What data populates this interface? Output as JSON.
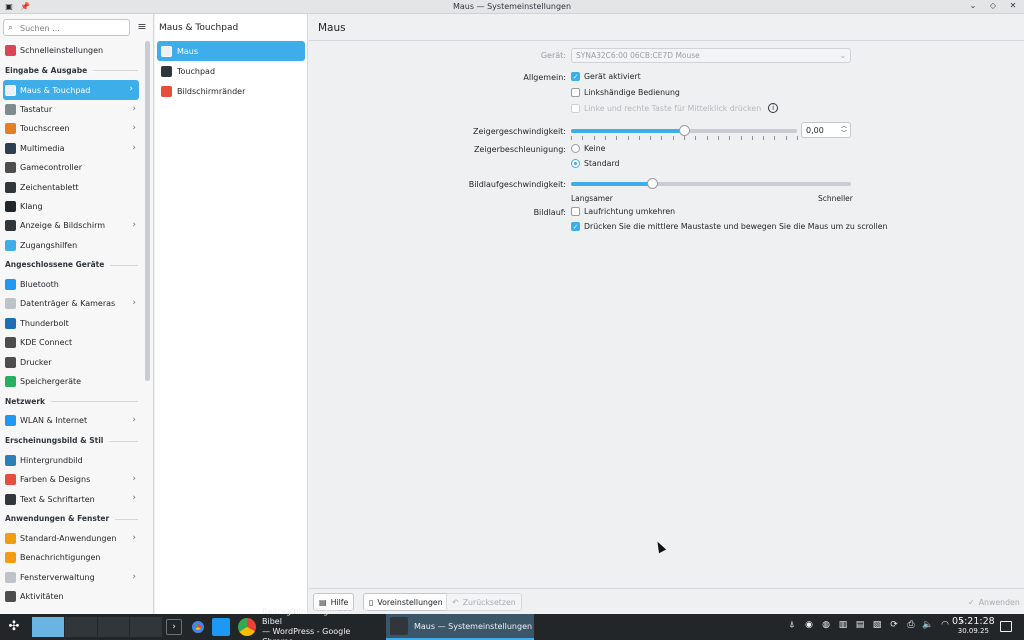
{
  "window": {
    "title": "Maus — Systemeinstellungen"
  },
  "search": {
    "placeholder": "Suchen ..."
  },
  "sidebar": {
    "top_item": {
      "label": "Schnelleinstellungen",
      "icon": "quick-settings-icon",
      "color": "#da4453"
    },
    "groups": [
      {
        "title": "Eingabe & Ausgabe",
        "items": [
          {
            "label": "Maus & Touchpad",
            "icon": "mouse-icon",
            "color": "#eff0f1",
            "chevron": true,
            "active": true
          },
          {
            "label": "Tastatur",
            "icon": "keyboard-icon",
            "color": "#7f8c8d",
            "chevron": true
          },
          {
            "label": "Touchscreen",
            "icon": "touchscreen-icon",
            "color": "#e67e22",
            "chevron": true
          },
          {
            "label": "Multimedia",
            "icon": "multimedia-icon",
            "color": "#2c3e50",
            "chevron": true
          },
          {
            "label": "Gamecontroller",
            "icon": "gamepad-icon",
            "color": "#4d4d4d"
          },
          {
            "label": "Zeichentablett",
            "icon": "tablet-icon",
            "color": "#31363b"
          },
          {
            "label": "Klang",
            "icon": "speaker-icon",
            "color": "#232629"
          },
          {
            "label": "Anzeige & Bildschirm",
            "icon": "display-icon",
            "color": "#31363b",
            "chevron": true
          },
          {
            "label": "Zugangshilfen",
            "icon": "accessibility-icon",
            "color": "#3daee9"
          }
        ]
      },
      {
        "title": "Angeschlossene Geräte",
        "items": [
          {
            "label": "Bluetooth",
            "icon": "bluetooth-icon",
            "color": "#1d99f3"
          },
          {
            "label": "Datenträger & Kameras",
            "icon": "drive-icon",
            "color": "#bdc3c7",
            "chevron": true
          },
          {
            "label": "Thunderbolt",
            "icon": "thunderbolt-icon",
            "color": "#1d6fb5"
          },
          {
            "label": "KDE Connect",
            "icon": "phone-icon",
            "color": "#4d4d4d"
          },
          {
            "label": "Drucker",
            "icon": "printer-icon",
            "color": "#4d4d4d"
          },
          {
            "label": "Speichergeräte",
            "icon": "storage-icon",
            "color": "#27ae60"
          }
        ]
      },
      {
        "title": "Netzwerk",
        "items": [
          {
            "label": "WLAN & Internet",
            "icon": "network-icon",
            "color": "#1d99f3",
            "chevron": true
          }
        ]
      },
      {
        "title": "Erscheinungsbild & Stil",
        "items": [
          {
            "label": "Hintergrundbild",
            "icon": "wallpaper-icon",
            "color": "#2980b9"
          },
          {
            "label": "Farben & Designs",
            "icon": "colors-icon",
            "color": "#e74c3c",
            "chevron": true
          },
          {
            "label": "Text & Schriftarten",
            "icon": "fonts-icon",
            "color": "#31363b",
            "chevron": true
          }
        ]
      },
      {
        "title": "Anwendungen & Fenster",
        "items": [
          {
            "label": "Standard-Anwendungen",
            "icon": "star-icon",
            "color": "#f39c12",
            "chevron": true
          },
          {
            "label": "Benachrichtigungen",
            "icon": "bell-icon",
            "color": "#f39c12"
          },
          {
            "label": "Fensterverwaltung",
            "icon": "window-icon",
            "color": "#bdc3c7",
            "chevron": true
          },
          {
            "label": "Aktivitäten",
            "icon": "activities-icon",
            "color": "#4d4d4d"
          }
        ]
      }
    ]
  },
  "subpanel": {
    "title": "Maus & Touchpad",
    "items": [
      {
        "label": "Maus",
        "icon": "mouse-icon",
        "color": "#eff0f1",
        "active": true
      },
      {
        "label": "Touchpad",
        "icon": "touchpad-icon",
        "color": "#31363b"
      },
      {
        "label": "Bildschirmränder",
        "icon": "screen-edges-icon",
        "color": "#e74c3c"
      }
    ]
  },
  "main": {
    "title": "Maus",
    "device": {
      "label": "Gerät:",
      "value": "SYNA32C6:00 06CB:CE7D Mouse"
    },
    "general": {
      "label": "Allgemein:",
      "enabled": {
        "label": "Gerät aktiviert",
        "checked": true
      },
      "left_handed": {
        "label": "Linkshändige Bedienung",
        "checked": false
      },
      "middle_click": {
        "label": "Linke und rechte Taste für Mittelklick drücken",
        "checked": false,
        "disabled": true
      }
    },
    "pointer_speed": {
      "label": "Zeigergeschwindigkeit:",
      "value": "0,00",
      "level": 0.5
    },
    "acceleration": {
      "label": "Zeigerbeschleunigung:",
      "options": [
        {
          "label": "Keine",
          "selected": false
        },
        {
          "label": "Standard",
          "selected": true
        }
      ]
    },
    "scroll_speed": {
      "label": "Bildlaufgeschwindigkeit:",
      "level": 0.29,
      "min_label": "Langsamer",
      "max_label": "Schneller"
    },
    "scrolling": {
      "label": "Bildlauf:",
      "invert": {
        "label": "Laufrichtung umkehren",
        "checked": false
      },
      "middle_scroll": {
        "label": "Drücken Sie die mittlere Maustaste und bewegen Sie die Maus um zu scrollen",
        "checked": true
      }
    },
    "buttons": {
      "help": "Hilfe",
      "defaults": "Voreinstellungen",
      "reset": "Zurücksetzen",
      "apply": "Anwenden"
    }
  },
  "taskbar": {
    "tasks": [
      {
        "label": "Beitrag hinzufügen ‹ Linux-Bibel — WordPress - Google Chrome",
        "line1": "Beitrag hinzufügen ‹ Linux-Bibel",
        "line2": "— WordPress - Google Chrome"
      },
      {
        "label": "Maus — Systemeinstellungen"
      }
    ],
    "clock": {
      "time": "05:21:28",
      "date": "30.09.25"
    }
  },
  "colors": {
    "accent": "#3daee9",
    "taskbar": "#232629"
  }
}
